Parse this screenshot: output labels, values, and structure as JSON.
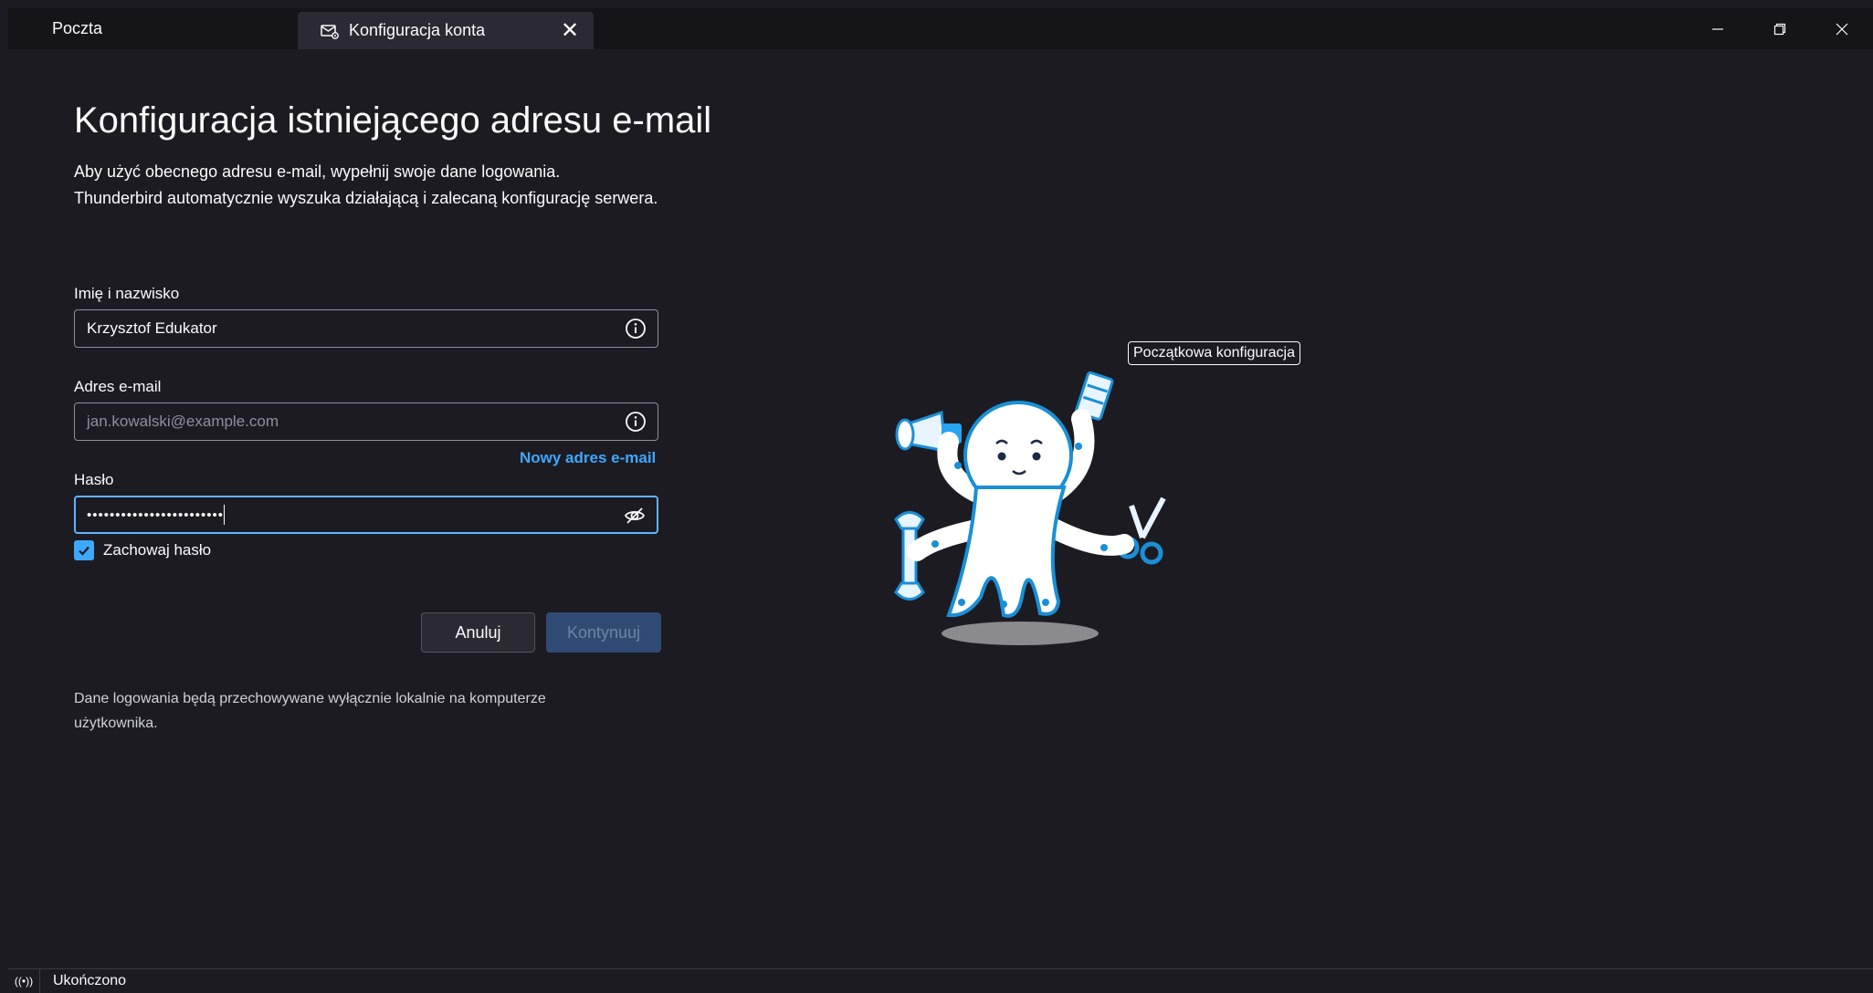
{
  "titlebar": {
    "mail_tab": "Poczta",
    "active_tab": "Konfiguracja konta",
    "close_glyph": "✕"
  },
  "window_controls": {
    "minimize": "—",
    "restore": "❐",
    "close": "✕"
  },
  "page": {
    "title": "Konfiguracja istniejącego adresu e-mail",
    "subtitle_line1": "Aby użyć obecnego adresu e-mail, wypełnij swoje dane logowania.",
    "subtitle_line2": "Thunderbird automatycznie wyszuka działającą i zalecaną konfigurację serwera."
  },
  "form": {
    "name_label": "Imię i nazwisko",
    "name_value": "Krzysztof Edukator",
    "email_label": "Adres e-mail",
    "email_placeholder": "jan.kowalski@example.com",
    "new_email_link": "Nowy adres e-mail",
    "password_label": "Hasło",
    "password_masked": "••••••••••••••••••••••••",
    "remember_password_label": "Zachowaj hasło",
    "remember_password_checked": true,
    "cancel_label": "Anuluj",
    "continue_label": "Kontynuuj"
  },
  "footer_note": {
    "line1": "Dane logowania będą przechowywane wyłącznie lokalnie na komputerze",
    "line2": "użytkownika."
  },
  "tooltip": "Początkowa konfiguracja",
  "statusbar": {
    "icon": "((•))",
    "text": "Ukończono"
  },
  "colors": {
    "background": "#1c1b22",
    "titlebar": "#151418",
    "accent": "#3ea8ff",
    "focus_border": "#5fb4ff",
    "button_disabled": "#2f4a73"
  },
  "icons": {
    "tab_icon": "mail-settings-icon",
    "field_info": "info-icon",
    "password_toggle": "eye-slash-icon",
    "illustration": "octopus-mascot"
  }
}
